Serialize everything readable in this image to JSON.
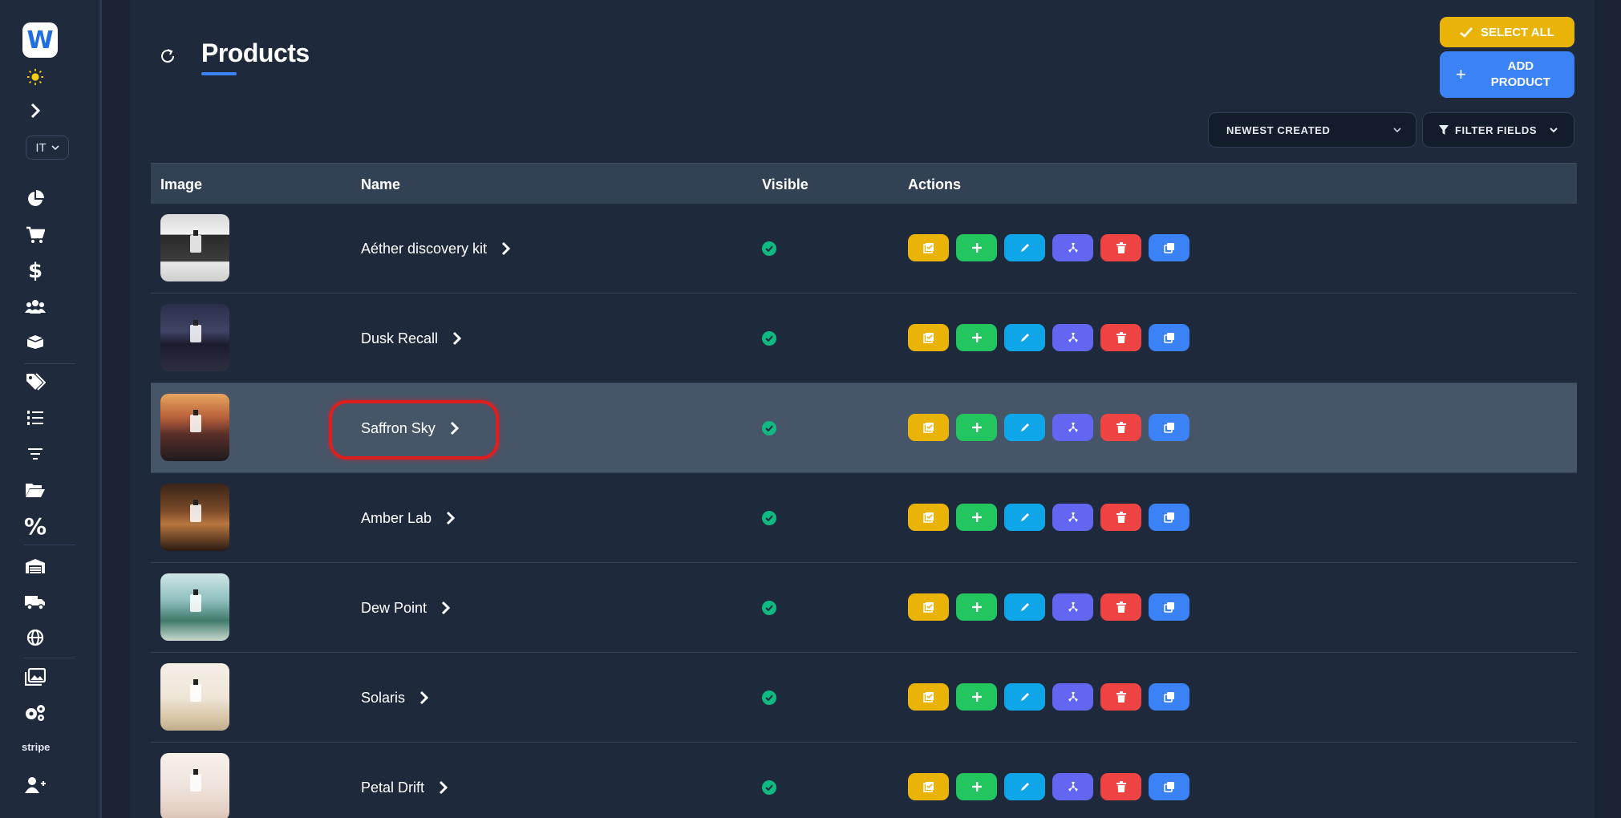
{
  "sidebar": {
    "logo_letter": "W",
    "language": "IT",
    "stripe_label": "stripe",
    "icons": [
      "sun-icon",
      "chevron-right-icon",
      "pie-chart-icon",
      "cart-icon",
      "dollar-icon",
      "users-icon",
      "boxes-icon",
      "tags-icon",
      "ordered-list-icon",
      "filter-lines-icon",
      "folder-open-icon",
      "percent-icon",
      "warehouse-icon",
      "truck-icon",
      "globe-icon",
      "images-icon",
      "gears-icon",
      "user-plus-icon"
    ]
  },
  "header": {
    "title": "Products",
    "select_all_label": "SELECT ALL",
    "add_product_label": "ADD PRODUCT",
    "sort_label": "NEWEST CREATED",
    "filter_label": "FILTER FIELDS"
  },
  "table": {
    "columns": [
      "Image",
      "Name",
      "Visible",
      "Actions"
    ],
    "rows": [
      {
        "name": "Aéther discovery kit",
        "visible": true
      },
      {
        "name": "Dusk Recall",
        "visible": true
      },
      {
        "name": "Saffron Sky",
        "visible": true,
        "highlighted": true
      },
      {
        "name": "Amber Lab",
        "visible": true
      },
      {
        "name": "Dew Point",
        "visible": true
      },
      {
        "name": "Solaris",
        "visible": true
      },
      {
        "name": "Petal Drift",
        "visible": true
      }
    ],
    "action_icons": [
      "checklist-icon",
      "plus-icon",
      "pencil-icon",
      "fan-icon",
      "trash-icon",
      "duplicate-icon"
    ]
  },
  "colors": {
    "accent": "#3b82f6",
    "select_all": "#eab308",
    "visible": "#10b981",
    "highlight_ring": "#e11d1d"
  }
}
